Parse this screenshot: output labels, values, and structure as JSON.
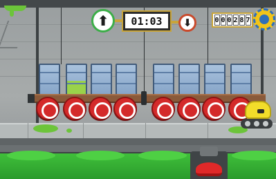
{
  "hud": {
    "up_icon": "up-arrow-icon",
    "down_icon": "down-arrow-icon",
    "up_glyph": "⬆",
    "down_glyph": "⬇",
    "timer": "01:03",
    "score_digits": [
      "0",
      "0",
      "0",
      "2",
      "8",
      "7"
    ],
    "settings_icon": "gear-icon"
  },
  "game": {
    "tank_count": 8,
    "tank_fill_levels": [
      0,
      0.45,
      0,
      0,
      0,
      0,
      0,
      0
    ],
    "button_count": 8,
    "colors": {
      "slime": "#6cc43a",
      "button_red": "#d42a2a",
      "robot_yellow": "#f2dd2a",
      "hud_gold": "#c8a43a"
    }
  }
}
